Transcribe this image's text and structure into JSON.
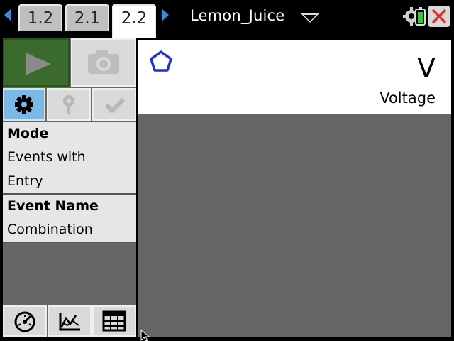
{
  "tabs": [
    {
      "label": "1.2",
      "active": false
    },
    {
      "label": "2.1",
      "active": false
    },
    {
      "label": "2.2",
      "active": true
    }
  ],
  "document": {
    "title": "Lemon_Juice"
  },
  "left_panel": {
    "mode": {
      "label": "Mode",
      "value_line1": "Events with",
      "value_line2": "Entry"
    },
    "event_name": {
      "label": "Event Name",
      "value": "Combination"
    }
  },
  "display": {
    "unit": "V",
    "quantity": "Voltage"
  },
  "colors": {
    "accent": "#2f8fe0",
    "play_bg": "#3a6b2c",
    "settings_bg": "#7ab8e8",
    "pentagon": "#1a2fe0",
    "close": "#e03030"
  }
}
